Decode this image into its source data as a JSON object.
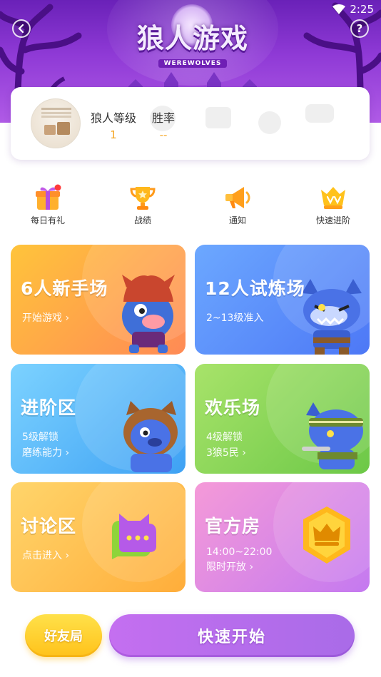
{
  "status_bar": {
    "time": "2:25"
  },
  "header": {
    "logo_title": "狼人游戏",
    "logo_subtitle": "WEREWOLVES",
    "back_icon": "chevron-left-icon",
    "help_icon": "question-icon",
    "help_label": "?"
  },
  "profile": {
    "level_label": "狼人等级",
    "level_value": "1",
    "winrate_label": "胜率",
    "winrate_value": "--"
  },
  "quick_actions": [
    {
      "label": "每日有礼",
      "icon": "gift-icon",
      "badge": true
    },
    {
      "label": "战绩",
      "icon": "trophy-icon",
      "badge": false
    },
    {
      "label": "通知",
      "icon": "megaphone-icon",
      "badge": false
    },
    {
      "label": "快速进阶",
      "icon": "level-up-icon",
      "badge": false
    }
  ],
  "modes": [
    {
      "title": "6人新手场",
      "line1": "开始游戏 ›",
      "line2": "",
      "color": "#ffb24a"
    },
    {
      "title": "12人试炼场",
      "line1": "2~13级准入",
      "line2": "",
      "color": "#5c8cf7"
    },
    {
      "title": "进阶区",
      "line1": "5级解锁",
      "line2": "磨练能力 ›",
      "color": "#4cb0f7"
    },
    {
      "title": "欢乐场",
      "line1": "4级解锁",
      "line2": "3狼5民 ›",
      "color": "#8ad55b"
    },
    {
      "title": "讨论区",
      "line1": "点击进入 ›",
      "line2": "",
      "color": "#ffc450"
    },
    {
      "title": "官方房",
      "line1": "14:00~22:00",
      "line2": "限时开放 ›",
      "color": "#e08ae6"
    }
  ],
  "bottom": {
    "friend_label": "好友局",
    "start_label": "快速开始"
  }
}
